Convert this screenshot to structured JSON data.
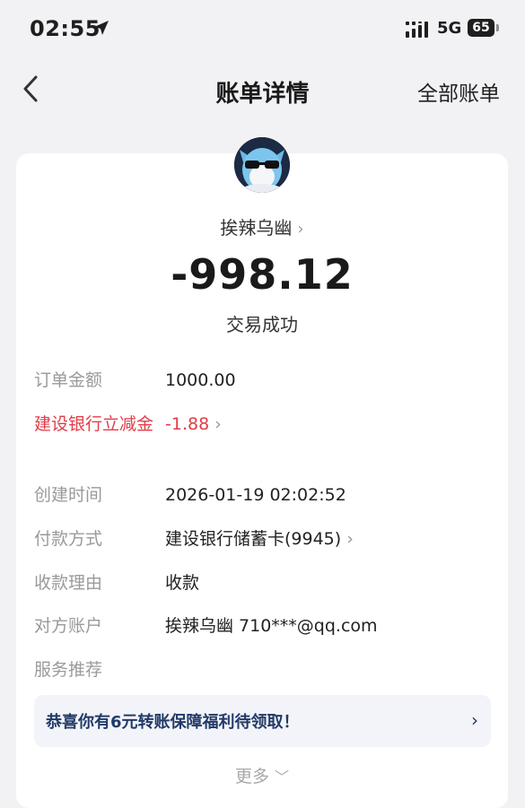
{
  "status_bar": {
    "time": "02:55",
    "network": "5G",
    "battery": "65"
  },
  "nav": {
    "title": "账单详情",
    "right_link": "全部账单"
  },
  "detail": {
    "payee": "挨辣乌幽",
    "amount": "-998.12",
    "status": "交易成功"
  },
  "rows": [
    {
      "label": "订单金额",
      "value": "1000.00"
    },
    {
      "label": "建设银行立减金",
      "value": "-1.88"
    },
    {
      "label": "创建时间",
      "value": "2026-01-19 02:02:52"
    },
    {
      "label": "付款方式",
      "value": "建设银行储蓄卡(9945)"
    },
    {
      "label": "收款理由",
      "value": "收款"
    },
    {
      "label": "对方账户",
      "value": "挨辣乌幽 710***@qq.com"
    },
    {
      "label": "服务推荐",
      "value": ""
    }
  ],
  "promo": {
    "text": "恭喜你有6元转账保障福利待领取！"
  },
  "more": {
    "label": "更多"
  },
  "colors": {
    "background": "#f2f2f4",
    "card": "#ffffff",
    "discount_red": "#e23c48",
    "promo_text": "#223a68",
    "promo_bg": "#f2f4f9"
  },
  "icons": [
    "location-arrow-icon",
    "signal-icon",
    "battery-icon",
    "back-chevron-icon",
    "chevron-right-icon",
    "chevron-down-icon",
    "avatar"
  ]
}
